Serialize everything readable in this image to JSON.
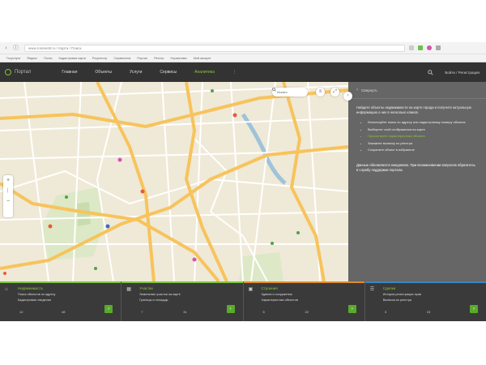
{
  "browser": {
    "url": "www.rosreestr.ru / Карта / Поиск",
    "bookmarks": [
      "Госуслуги",
      "Яндекс",
      "Почта",
      "Кадастровая карта",
      "Росреестр",
      "Справочник",
      "Портал",
      "Реестр",
      "Нормативы",
      "Мой аккаунт"
    ]
  },
  "header": {
    "logo_text": "Портал",
    "tabs": [
      "Главная",
      "Объекты",
      "Услуги",
      "Сервисы",
      "Аналитика"
    ],
    "active_tab_index": 4,
    "more": "⋮",
    "user": "Войти / Регистрация"
  },
  "map": {
    "search_label": "Искать",
    "zoom_in": "+",
    "zoom_out": "−"
  },
  "panel": {
    "header_label": "Свернуть",
    "intro": "Найдите объекты недвижимости на карте города и получите актуальную информацию о них в несколько кликов.",
    "items": [
      "Используйте поиск по адресу или кадастровому номеру объекта",
      "Выберите слой отображения на карте",
      "Просмотрите характеристики объекта",
      "Закажите выписку из реестра",
      "Сохраните объект в избранное"
    ],
    "footer": "Данные обновляются ежедневно. При возникновении вопросов обратитесь в службу поддержки портала."
  },
  "cards": [
    {
      "title": "Недвижимость",
      "color": "#7cc242",
      "line1": "Поиск объектов по адресу",
      "line2": "Кадастровые сведения",
      "stat1": "12",
      "stat2": "48"
    },
    {
      "title": "Участки",
      "color": "#7cc242",
      "line1": "Земельные участки на карте",
      "line2": "Границы и площадь",
      "stat1": "7",
      "stat2": "31"
    },
    {
      "title": "Строения",
      "color": "#e08a2e",
      "line1": "Здания и сооружения",
      "line2": "Характеристики объектов",
      "stat1": "5",
      "stat2": "22"
    },
    {
      "title": "Сделки",
      "color": "#3b86c6",
      "line1": "История регистрации прав",
      "line2": "Выписки из реестра",
      "stat1": "3",
      "stat2": "15"
    }
  ]
}
